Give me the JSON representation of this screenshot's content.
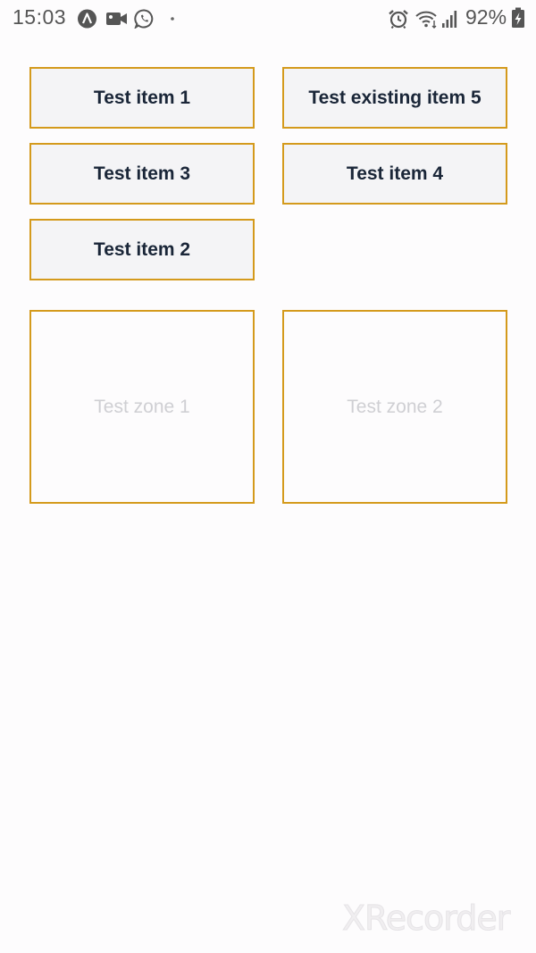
{
  "status_bar": {
    "time": "15:03",
    "battery": "92%",
    "icons": [
      "app-a-icon",
      "video-camera-icon",
      "whatsapp-icon",
      "dot-icon",
      "alarm-icon",
      "wifi-icon",
      "signal-icon",
      "battery-charging-icon"
    ]
  },
  "items": [
    {
      "label": "Test item 1"
    },
    {
      "label": "Test existing item 5"
    },
    {
      "label": "Test item 3"
    },
    {
      "label": "Test item 4"
    },
    {
      "label": "Test item 2"
    }
  ],
  "zones": [
    {
      "label": "Test zone 1"
    },
    {
      "label": "Test zone 2"
    }
  ],
  "watermark": "XRecorder",
  "colors": {
    "border": "#d49a1c",
    "item_bg": "#f4f4f6",
    "item_text": "#1a2638",
    "zone_text": "#cfcfd3"
  }
}
